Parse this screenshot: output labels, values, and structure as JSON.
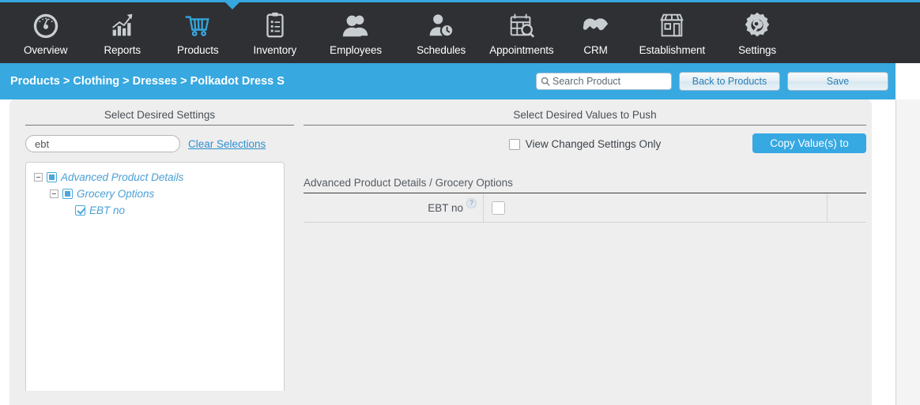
{
  "nav": {
    "active": "Products",
    "items": [
      {
        "label": "Overview",
        "icon": "gauge-icon"
      },
      {
        "label": "Reports",
        "icon": "bar-chart-arrow-icon"
      },
      {
        "label": "Products",
        "icon": "shopping-cart-icon"
      },
      {
        "label": "Inventory",
        "icon": "clipboard-checklist-icon"
      },
      {
        "label": "Employees",
        "icon": "people-icon"
      },
      {
        "label": "Schedules",
        "icon": "person-clock-icon"
      },
      {
        "label": "Appointments",
        "icon": "calendar-search-icon"
      },
      {
        "label": "CRM",
        "icon": "handshake-icon"
      },
      {
        "label": "Establishment",
        "icon": "storefront-icon"
      },
      {
        "label": "Settings",
        "icon": "gear-wrench-icon"
      }
    ]
  },
  "bluebar": {
    "breadcrumb": "Products > Clothing > Dresses > Polkadot Dress S",
    "search_placeholder": "Search Product",
    "search_value": "",
    "search_icon": "magnifier-icon",
    "back_label": "Back to Products",
    "save_label": "Save"
  },
  "left": {
    "title": "Select Desired Settings",
    "filter_value": "ebt",
    "filter_placeholder": "",
    "clear_label": "Clear Selections",
    "tree": [
      {
        "level": 1,
        "label": "Advanced Product Details",
        "state": "partial",
        "expander": "minus"
      },
      {
        "level": 2,
        "label": "Grocery Options",
        "state": "partial",
        "expander": "minus"
      },
      {
        "level": 3,
        "label": "EBT no",
        "state": "checked",
        "expander": "none"
      }
    ]
  },
  "right": {
    "title": "Select Desired Values to Push",
    "view_changed_label": "View Changed Settings Only",
    "view_changed_checked": false,
    "copy_label": "Copy Value(s) to",
    "section_title": "Advanced Product Details / Grocery Options",
    "rows": [
      {
        "label": "EBT no",
        "help_icon": "question-mark-icon",
        "value_checked": false
      }
    ]
  },
  "colors": {
    "accent": "#36a8e2",
    "navbar": "#2f3033",
    "panel": "#eeeeee",
    "tree_text": "#4a9fd4"
  }
}
